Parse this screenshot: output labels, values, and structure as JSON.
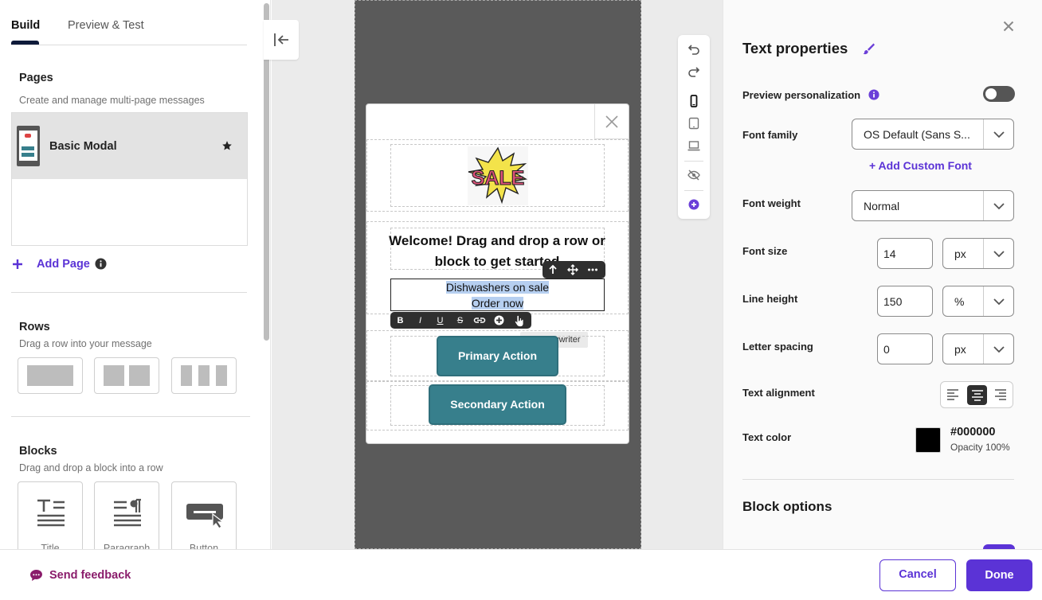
{
  "left_panel": {
    "tabs": [
      "Build",
      "Preview & Test"
    ],
    "pages": {
      "title": "Pages",
      "subtitle": "Create and manage multi-page messages",
      "page_name": "Basic Modal",
      "add_page": "Add Page"
    },
    "rows": {
      "title": "Rows",
      "subtitle": "Drag a row into your message"
    },
    "blocks": {
      "title": "Blocks",
      "subtitle": "Drag and drop a block into a row",
      "items": [
        "Title",
        "Paragraph",
        "Button"
      ]
    }
  },
  "canvas": {
    "image_text": "SALE",
    "heading": "Welcome! Drag and drop a row or block to get started",
    "body_line1": "Dishwashers on sale",
    "body_line2": "Order now",
    "format_bar": [
      "B",
      "I",
      "U",
      "S"
    ],
    "tooltip": "AI Copywriter",
    "primary_button": "Primary Action",
    "secondary_button": "Secondary Action"
  },
  "toolbar_icons": [
    "undo-icon",
    "redo-icon",
    "mobile-icon",
    "tablet-icon",
    "desktop-icon",
    "hide-icon",
    "add-icon"
  ],
  "properties": {
    "title": "Text properties",
    "preview_personalization": "Preview personalization",
    "preview_toggle_on": false,
    "font_family_label": "Font family",
    "font_family": "OS Default (Sans S...",
    "add_custom_font": "+ Add Custom Font",
    "font_weight_label": "Font weight",
    "font_weight": "Normal",
    "font_size_label": "Font size",
    "font_size": "14",
    "font_size_unit": "px",
    "line_height_label": "Line height",
    "line_height": "150",
    "line_height_unit": "%",
    "letter_spacing_label": "Letter spacing",
    "letter_spacing": "0",
    "letter_spacing_unit": "px",
    "text_alignment_label": "Text alignment",
    "alignment": "center",
    "text_color_label": "Text color",
    "text_color": "#000000",
    "opacity": "Opacity 100%",
    "block_options": "Block options"
  },
  "footer": {
    "feedback": "Send feedback",
    "cancel": "Cancel",
    "done": "Done"
  },
  "colors": {
    "accent": "#5b33d6",
    "feedback": "#8a1c6b",
    "teal": "#377f8c"
  }
}
